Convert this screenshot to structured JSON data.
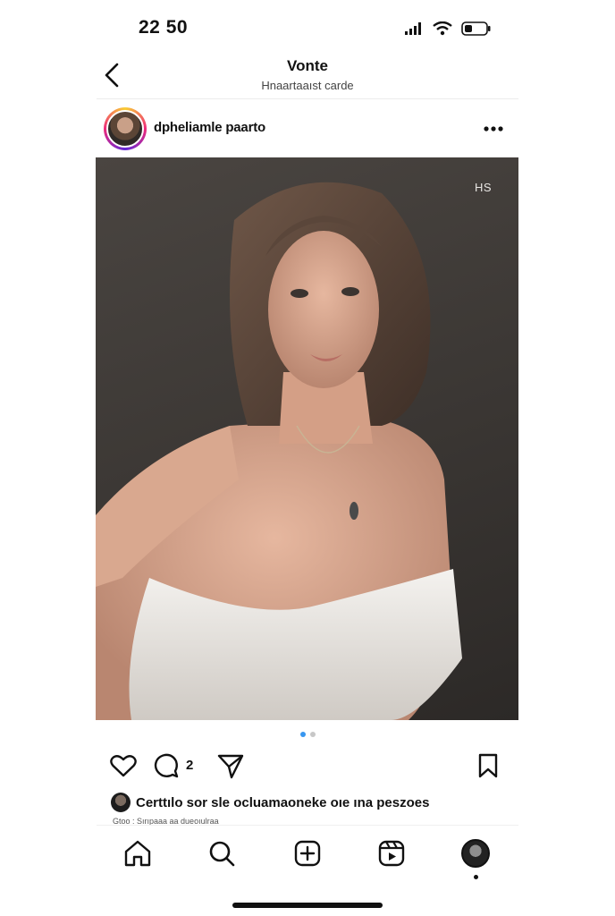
{
  "status_bar": {
    "time": "22 50",
    "icons": [
      "signal-icon",
      "wifi-icon",
      "battery-icon"
    ]
  },
  "header": {
    "title": "Vonte",
    "subtitle": "Hnaartaaıst carde"
  },
  "post": {
    "username": "dpheliamle paarto",
    "photo_badge": "HS",
    "carousel": {
      "total_dots": 2,
      "active_index": 0
    },
    "comment_count": "2",
    "likes_text": "Certtılo sor sle ocluamaoneke oıe ına peszoes",
    "caption_text": "Gtoo : Sırıpaaa aa dueoıulraa"
  },
  "tab_bar": {
    "items": [
      "home-icon",
      "search-icon",
      "create-icon",
      "reels-icon",
      "profile-avatar"
    ]
  },
  "colors": {
    "background": "#ffffff",
    "text": "#111111",
    "accent_blue": "#3897f0",
    "photo_backdrop": "#3a3633"
  }
}
